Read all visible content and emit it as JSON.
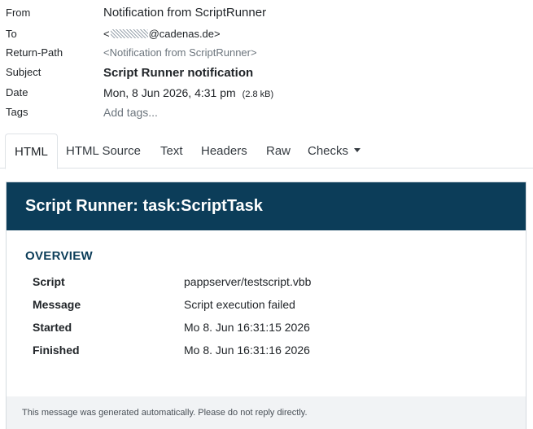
{
  "headers": {
    "from": {
      "label": "From",
      "value": "Notification from ScriptRunner"
    },
    "to": {
      "label": "To",
      "prefix": "<",
      "value": "@cadenas.de>"
    },
    "return_path": {
      "label": "Return-Path",
      "value": "<Notification from ScriptRunner>"
    },
    "subject": {
      "label": "Subject",
      "value": "Script Runner notification"
    },
    "date": {
      "label": "Date",
      "value": "Mon, 8 Jun 2026, 4:31 pm",
      "size": "(2.8 kB)"
    },
    "tags": {
      "label": "Tags",
      "placeholder": "Add tags..."
    }
  },
  "tabs": [
    "HTML",
    "HTML Source",
    "Text",
    "Headers",
    "Raw",
    "Checks"
  ],
  "email": {
    "banner_title": "Script Runner: task:ScriptTask",
    "section_title": "OVERVIEW",
    "rows": [
      {
        "key": "Script",
        "value": "pappserver/testscript.vbb"
      },
      {
        "key": "Message",
        "value": "Script execution failed"
      },
      {
        "key": "Started",
        "value": "Mo 8. Jun 16:31:15 2026"
      },
      {
        "key": "Finished",
        "value": "Mo 8. Jun 16:31:16 2026"
      }
    ],
    "footer": "This message was generated automatically. Please do not reply directly."
  },
  "colors": {
    "banner": "#0c3d59",
    "section_title": "#0c3d59",
    "footer_bg": "#f1f3f5"
  },
  "icons": {
    "checks_dropdown": "caret-down-icon",
    "redaction": "redacted-text"
  }
}
